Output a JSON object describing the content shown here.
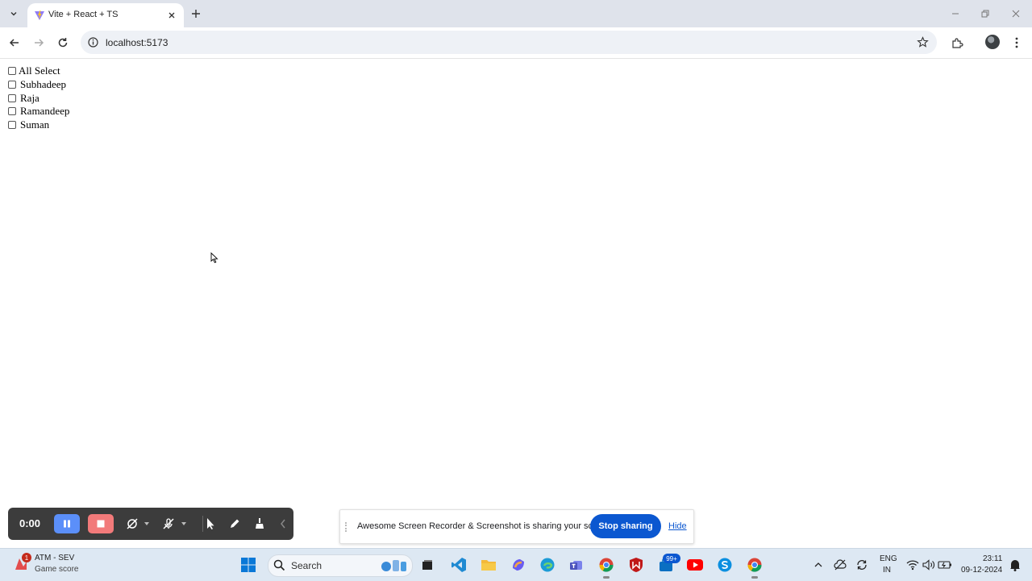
{
  "browser": {
    "tab_title": "Vite + React + TS",
    "url": "localhost:5173"
  },
  "page": {
    "checkboxes": [
      {
        "label": "All Select",
        "checked": false
      },
      {
        "label": "Subhadeep",
        "checked": false
      },
      {
        "label": "Raja",
        "checked": false
      },
      {
        "label": "Ramandeep",
        "checked": false
      },
      {
        "label": "Suman",
        "checked": false
      }
    ]
  },
  "recorder": {
    "time": "0:00"
  },
  "share_bar": {
    "message": "Awesome Screen Recorder & Screenshot is sharing your screen.",
    "stop_label": "Stop sharing",
    "hide_label": "Hide"
  },
  "taskbar": {
    "game_title": "ATM - SEV",
    "game_subtitle": "Game score",
    "game_badge": "1",
    "search_label": "Search",
    "teams_badge": "99+",
    "lang_line1": "ENG",
    "lang_line2": "IN",
    "time": "23:11",
    "date": "09-12-2024"
  },
  "colors": {
    "accent": "#0b57d0",
    "pause": "#5b8ff9",
    "stop": "#f27a7a",
    "tabbar": "#dfe3eb",
    "taskbar": "#dde8f3"
  }
}
